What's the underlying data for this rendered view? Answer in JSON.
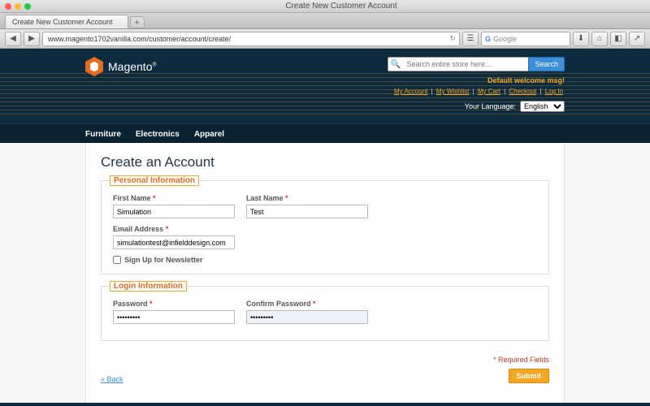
{
  "os": {
    "window_title": "Create New Customer Account",
    "tab_title": "Create New Customer Account",
    "url": "www.magento1702vanilla.com/customer/account/create/",
    "browser_search_placeholder": "Google"
  },
  "header": {
    "brand": "Magento",
    "search_placeholder": "Search entire store here...",
    "search_button": "Search",
    "welcome": "Default welcome msg!",
    "links": [
      "My Account",
      "My Wishlist",
      "My Cart",
      "Checkout",
      "Log In"
    ],
    "language_label": "Your Language:",
    "language_value": "English"
  },
  "nav": [
    "Furniture",
    "Electronics",
    "Apparel"
  ],
  "page": {
    "title": "Create an Account",
    "legend_personal": "Personal Information",
    "legend_login": "Login Information",
    "first_name_label": "First Name",
    "first_name_value": "Simulation",
    "last_name_label": "Last Name",
    "last_name_value": "Test",
    "email_label": "Email Address",
    "email_value": "simulationtest@infielddesign.com",
    "newsletter_label": "Sign Up for Newsletter",
    "password_label": "Password",
    "password_value": "•••••••••",
    "confirm_label": "Confirm Password",
    "confirm_value": "•••••••••",
    "required_note": "* Required Fields",
    "back": "« Back",
    "submit": "Submit"
  }
}
